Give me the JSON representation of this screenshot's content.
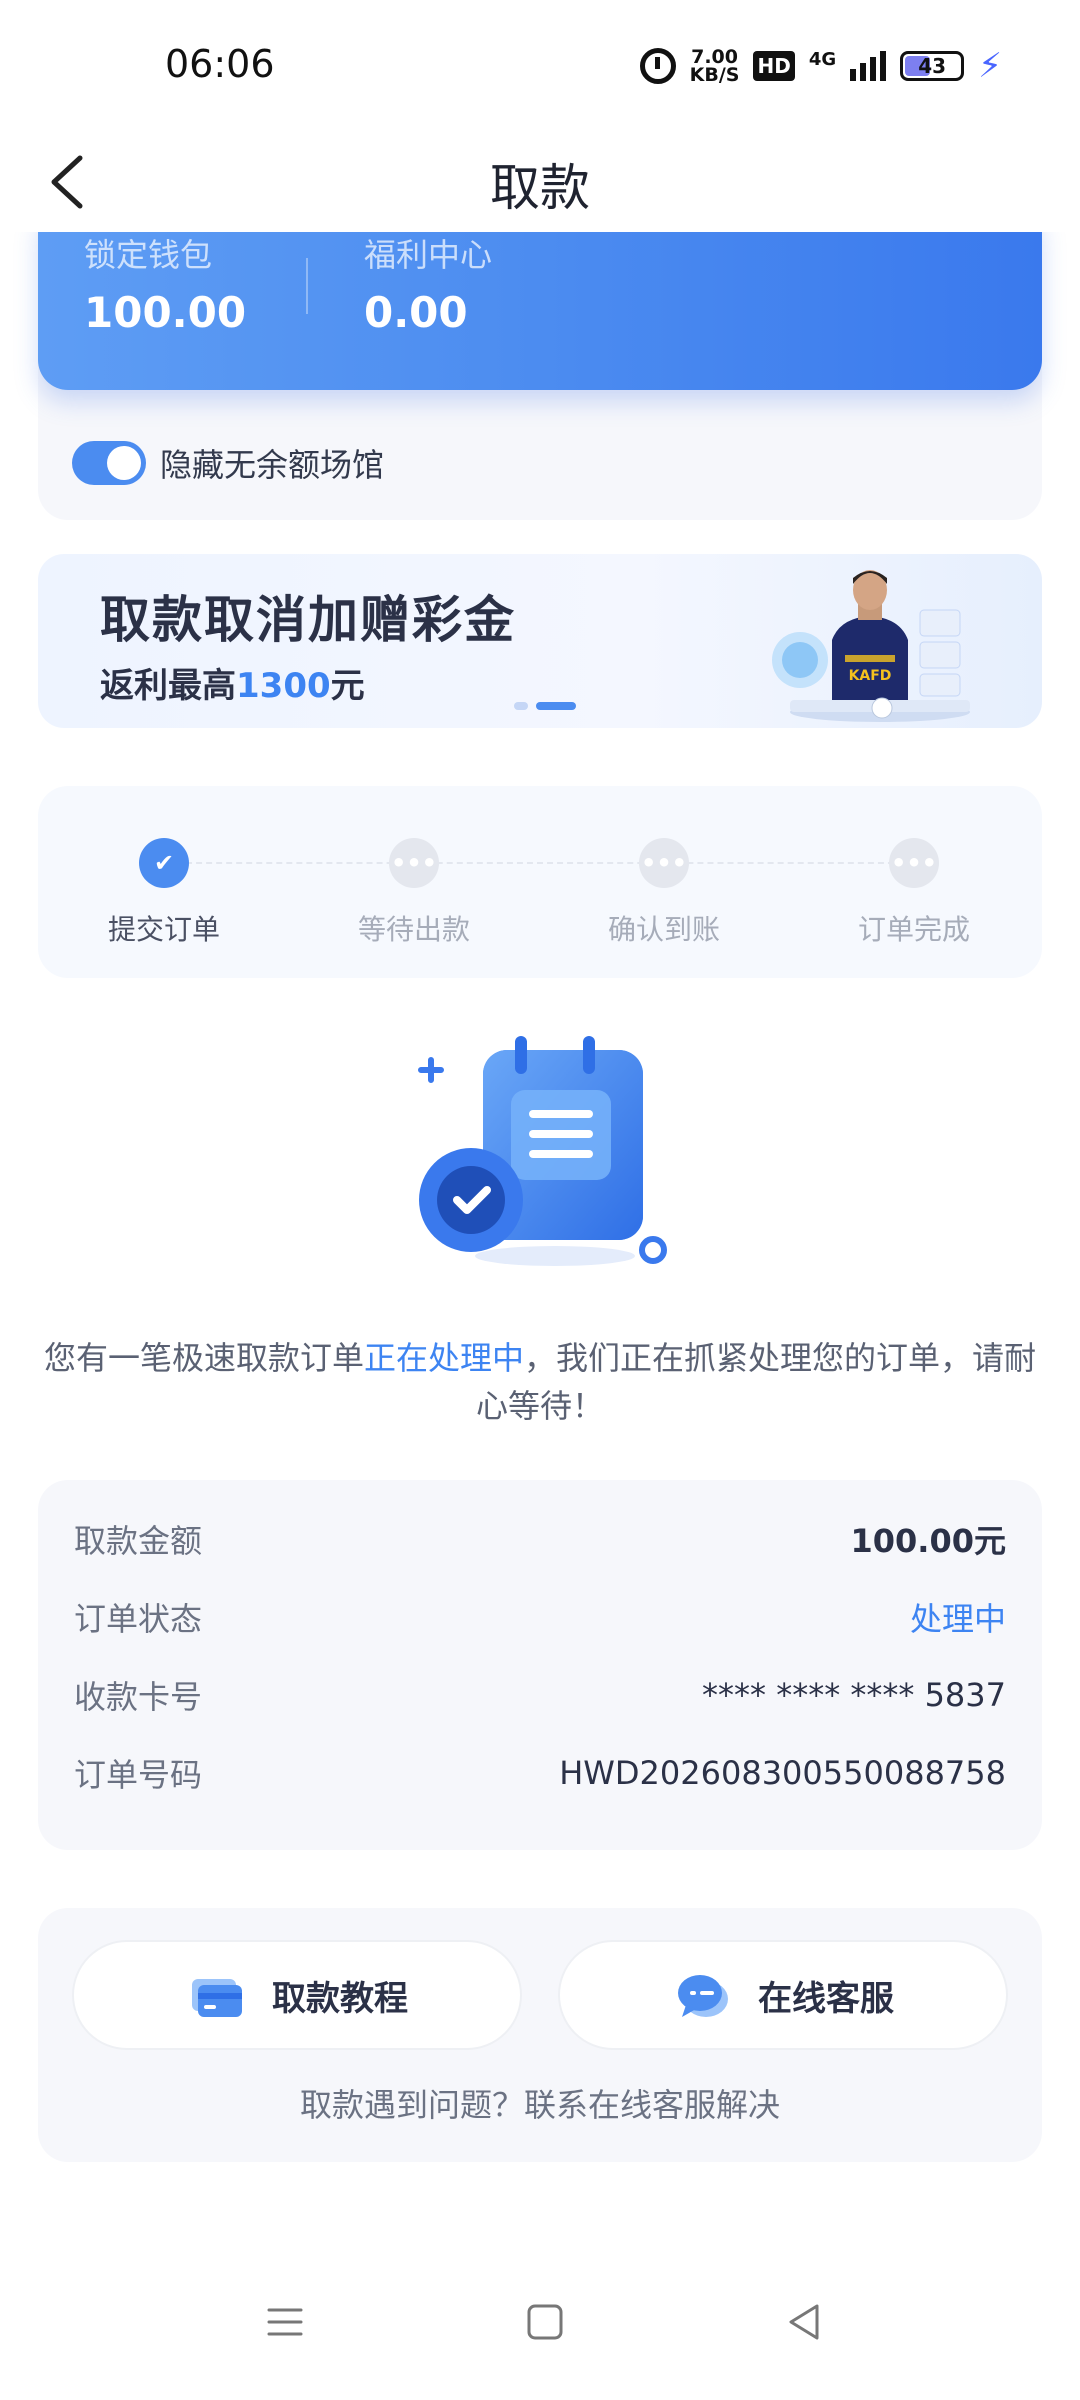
{
  "status_bar": {
    "time": "06:06",
    "speed_value": "7.00",
    "speed_unit": "KB/S",
    "hd": "HD",
    "network": "4G",
    "battery": "43"
  },
  "header": {
    "title": "取款"
  },
  "wallet": {
    "items": [
      {
        "label": "锁定钱包",
        "value": "100.00"
      },
      {
        "label": "福利中心",
        "value": "0.00"
      }
    ],
    "hide_toggle_label": "隐藏无余额场馆",
    "hide_toggle_on": true
  },
  "banner": {
    "title": "取款取消加赠彩金",
    "subtitle_prefix": "返利最高",
    "subtitle_amount": "1300",
    "subtitle_suffix": "元",
    "art_text": "KAFD",
    "slide_count": 2,
    "active_slide": 2
  },
  "steps": [
    {
      "label": "提交订单",
      "done": true
    },
    {
      "label": "等待出款",
      "done": false
    },
    {
      "label": "确认到账",
      "done": false
    },
    {
      "label": "订单完成",
      "done": false
    }
  ],
  "step_pending_glyph": "•••",
  "step_done_glyph": "✔",
  "notice": {
    "part1": "您有一笔极速取款订单",
    "highlight": "正在处理中",
    "part2": "，我们正在抓紧处理您的订单，请耐心等待！"
  },
  "details": [
    {
      "label": "取款金额",
      "value": "100.00元"
    },
    {
      "label": "订单状态",
      "value": "处理中"
    },
    {
      "label": "收款卡号",
      "value": "**** **** **** 5837"
    },
    {
      "label": "订单号码",
      "value": "HWD2026083005500887​58"
    }
  ],
  "help": {
    "tutorial_label": "取款教程",
    "service_label": "在线客服",
    "footer_text": "取款遇到问题？联系在线客服解决"
  },
  "colors": {
    "accent": "#4B8CF0",
    "highlight_text": "#3D84F2",
    "wallet_gradient_start": "#5E9DF4",
    "wallet_gradient_end": "#3A79ED"
  }
}
